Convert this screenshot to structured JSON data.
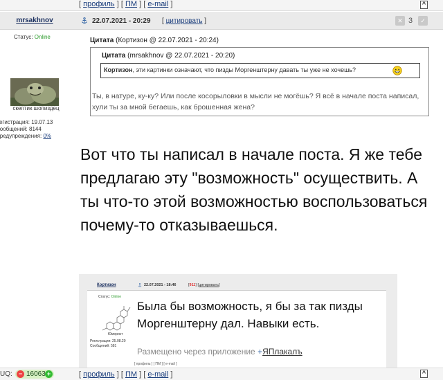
{
  "nav_links": {
    "open": "[",
    "profile": "профиль",
    "sep1": "] [",
    "pm": "ПМ",
    "sep2": "] [",
    "email": "e-mail",
    "close": "]"
  },
  "up_button": "^",
  "post": {
    "username": "mrsakhnov",
    "status_label": "Статус:",
    "status_value": "Online",
    "user_title": "скептик шопиздец",
    "stats": {
      "registration": "Регистрация: 19.07.13",
      "messages": "Сообщений: 8144",
      "warnings_label": "Предупреждения:",
      "warnings_value": "0%"
    },
    "date": "22.07.2021 - 20:29",
    "quote_open": "[",
    "quote_link": "цитировать",
    "quote_close": "]",
    "rating": "3"
  },
  "quote_outer": {
    "label": "Цитата",
    "meta": "(Кортизон @ 22.07.2021 - 20:24)",
    "text": "Ты, в натуре, ку-ку? Или после косорыловки в мысли не могёшь? Я всё в начале поста написал, хули ты за мной бегаешь, как брошенная жена?"
  },
  "quote_inner": {
    "label": "Цитата",
    "meta": "(mrsakhnov @ 22.07.2021 - 20:20)",
    "author": "Кортизон",
    "text": ", эти картинки означают, что пизды Моргенштерну давать ты уже не хочешь?"
  },
  "main_text": "Вот что ты написал в начале поста. Я же тебе предлагаю эту \"возможность\" осуществить. А ты что-то этой возможностью воспользоваться почему-то отказываешься.",
  "screenshot": {
    "username": "Кортизон",
    "date": "22.07.2021 - 18:46",
    "num_open": "[",
    "num": "911",
    "num_mid": "] [",
    "quote_link": "цитировать",
    "num_close": "]",
    "status_label": "Статус:",
    "status_value": "Online",
    "user_title": "Юморист",
    "stats": {
      "registration": "Регистрация: 25.08.20",
      "messages": "Сообщений: 581"
    },
    "text": "Была бы возможность, я бы за так пизды Моргенштерну дал. Навыки есть.",
    "via_prefix": "Размещено через приложение",
    "via_brand": "ЯПлакалъ",
    "bottom_links": "[ профиль ] [ ПМ ] [ e-mail ]"
  },
  "footer": {
    "uq_label": "UQ:",
    "karma_minus": "−",
    "karma_value": "16063",
    "karma_plus": "+"
  }
}
